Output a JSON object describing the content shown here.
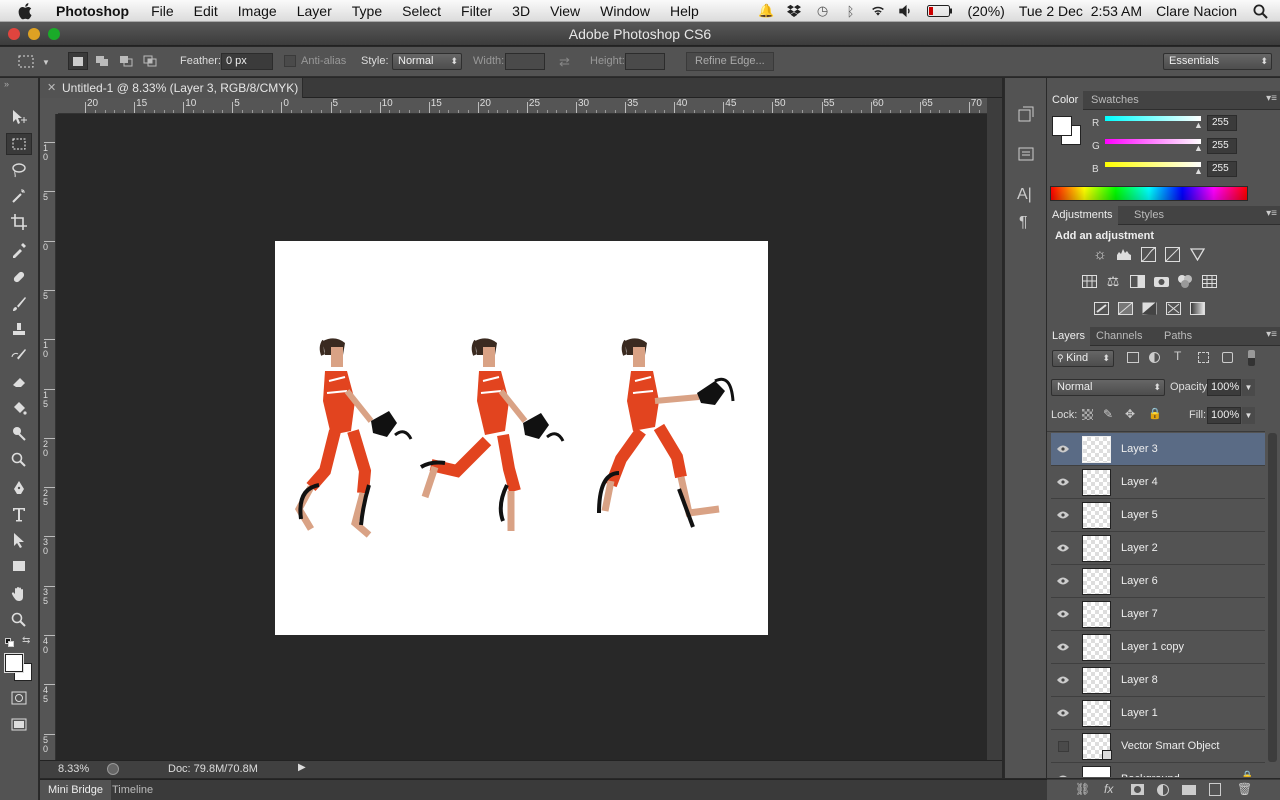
{
  "menubar": {
    "app_name": "Photoshop",
    "items": [
      "File",
      "Edit",
      "Image",
      "Layer",
      "Type",
      "Select",
      "Filter",
      "3D",
      "View",
      "Window",
      "Help"
    ],
    "battery": "(20%)",
    "datetime": "Tue 2 Dec  2:53 AM",
    "user": "Clare Nacion"
  },
  "window": {
    "title": "Adobe Photoshop CS6"
  },
  "options": {
    "feather_label": "Feather:",
    "feather_value": "0 px",
    "antialias_label": "Anti-alias",
    "style_label": "Style:",
    "style_value": "Normal",
    "width_label": "Width:",
    "height_label": "Height:",
    "refine_edge": "Refine Edge...",
    "workspace": "Essentials"
  },
  "document": {
    "tab_title": "Untitled-1 @ 8.33% (Layer 3, RGB/8/CMYK) *",
    "zoom": "8.33%",
    "doc_size": "Doc: 79.8M/70.8M"
  },
  "rulers": {
    "top_labels": [
      "20",
      "15",
      "10",
      "5",
      "0",
      "5",
      "10",
      "15",
      "20",
      "25",
      "30",
      "35",
      "40",
      "45",
      "50",
      "55",
      "60",
      "65",
      "70"
    ],
    "left_labels": [
      "1\n0",
      "5",
      "0",
      "5",
      "1\n0",
      "1\n5",
      "2\n0",
      "2\n5",
      "3\n0",
      "3\n5",
      "4\n0",
      "4\n5",
      "5\n0"
    ]
  },
  "color_panel": {
    "tabs": [
      "Color",
      "Swatches"
    ],
    "channels": [
      {
        "label": "R",
        "value": "255",
        "gradient": [
          "#00ffff",
          "#ffffff"
        ]
      },
      {
        "label": "G",
        "value": "255",
        "gradient": [
          "#ff00ff",
          "#ffffff"
        ]
      },
      {
        "label": "B",
        "value": "255",
        "gradient": [
          "#ffff00",
          "#ffffff"
        ]
      }
    ]
  },
  "adjustments_panel": {
    "tabs": [
      "Adjustments",
      "Styles"
    ],
    "heading": "Add an adjustment"
  },
  "layers_panel": {
    "tabs": [
      "Layers",
      "Channels",
      "Paths"
    ],
    "filter_kind": "Kind",
    "blend_mode": "Normal",
    "opacity_label": "Opacity:",
    "opacity_value": "100%",
    "lock_label": "Lock:",
    "fill_label": "Fill:",
    "fill_value": "100%",
    "layers": [
      {
        "name": "Layer 3",
        "visible": true,
        "selected": true
      },
      {
        "name": "Layer 4",
        "visible": true
      },
      {
        "name": "Layer 5",
        "visible": true
      },
      {
        "name": "Layer 2",
        "visible": true
      },
      {
        "name": "Layer 6",
        "visible": true
      },
      {
        "name": "Layer 7",
        "visible": true
      },
      {
        "name": "Layer 1 copy",
        "visible": true
      },
      {
        "name": "Layer 8",
        "visible": true
      },
      {
        "name": "Layer 1",
        "visible": true
      },
      {
        "name": "Vector Smart Object",
        "visible": false
      },
      {
        "name": "Background",
        "visible": true
      }
    ]
  },
  "bottom_tabs": [
    "Mini Bridge",
    "Timeline"
  ],
  "colors": {
    "accent_selected": "#5a6b85",
    "panel_bg": "#535353",
    "pasteboard": "#282828"
  }
}
